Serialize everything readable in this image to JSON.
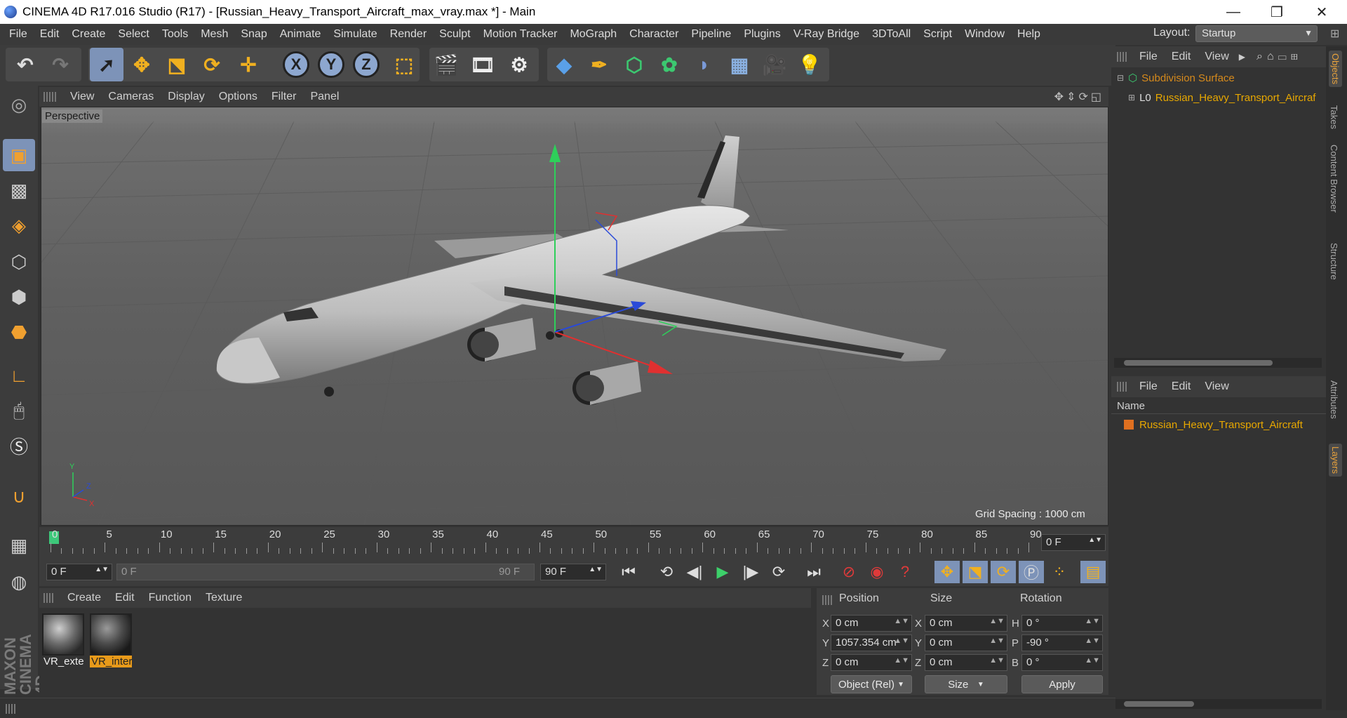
{
  "window": {
    "title": "CINEMA 4D R17.016 Studio (R17) - [Russian_Heavy_Transport_Aircraft_max_vray.max *] - Main",
    "controls": [
      "—",
      "❐",
      "✕"
    ]
  },
  "menubar": {
    "items": [
      "File",
      "Edit",
      "Create",
      "Select",
      "Tools",
      "Mesh",
      "Snap",
      "Animate",
      "Simulate",
      "Render",
      "Sculpt",
      "Motion Tracker",
      "MoGraph",
      "Character",
      "Pipeline",
      "Plugins",
      "V-Ray Bridge",
      "3DToAll",
      "Script",
      "Window",
      "Help"
    ],
    "layout_label": "Layout:",
    "layout_value": "Startup"
  },
  "toolbar": {
    "axis_labels": [
      "X",
      "Y",
      "Z"
    ]
  },
  "viewport": {
    "menu": [
      "View",
      "Cameras",
      "Display",
      "Options",
      "Filter",
      "Panel"
    ],
    "label": "Perspective",
    "grid_spacing": "Grid Spacing : 1000 cm",
    "axis_gizmo": {
      "y": "Y",
      "z": "Z",
      "x": "X"
    }
  },
  "timeline": {
    "ticks": [
      "0",
      "5",
      "10",
      "15",
      "20",
      "25",
      "30",
      "35",
      "40",
      "45",
      "50",
      "55",
      "60",
      "65",
      "70",
      "75",
      "80",
      "85",
      "90"
    ],
    "current_frame": "0 F",
    "start_field": "0 F",
    "slider_left": "0 F",
    "slider_right": "90 F",
    "end_field": "90 F",
    "current_progress": 0
  },
  "materials": {
    "menu": [
      "Create",
      "Edit",
      "Function",
      "Texture"
    ],
    "items": [
      {
        "name": "VR_exte",
        "selected": false
      },
      {
        "name": "VR_inter",
        "selected": true
      }
    ]
  },
  "coordinates": {
    "headers": [
      "Position",
      "Size",
      "Rotation"
    ],
    "rows": [
      {
        "pos_label": "X",
        "pos": "0 cm",
        "size_label": "X",
        "size": "0 cm",
        "rot_label": "H",
        "rot": "0 °"
      },
      {
        "pos_label": "Y",
        "pos": "1057.354 cm",
        "size_label": "Y",
        "size": "0 cm",
        "rot_label": "P",
        "rot": "-90 °"
      },
      {
        "pos_label": "Z",
        "pos": "0 cm",
        "size_label": "Z",
        "size": "0 cm",
        "rot_label": "B",
        "rot": "0 °"
      }
    ],
    "mode": "Object (Rel)",
    "size_mode": "Size",
    "apply": "Apply"
  },
  "objects_panel": {
    "menu": [
      "File",
      "Edit",
      "View"
    ],
    "items": [
      {
        "name": "Subdivision Surface",
        "color": "#d68a1c"
      },
      {
        "name": "Russian_Heavy_Transport_Aircraf",
        "color": "#e8a800"
      }
    ]
  },
  "layers_panel": {
    "menu": [
      "File",
      "Edit",
      "View"
    ],
    "column": "Name",
    "items": [
      {
        "name": "Russian_Heavy_Transport_Aircraft",
        "color": "#e07020"
      }
    ]
  },
  "right_tabs": [
    "Objects",
    "Takes",
    "Content Browser",
    "Structure",
    "Attributes",
    "Layers"
  ],
  "branding": "MAXON CINEMA 4D"
}
